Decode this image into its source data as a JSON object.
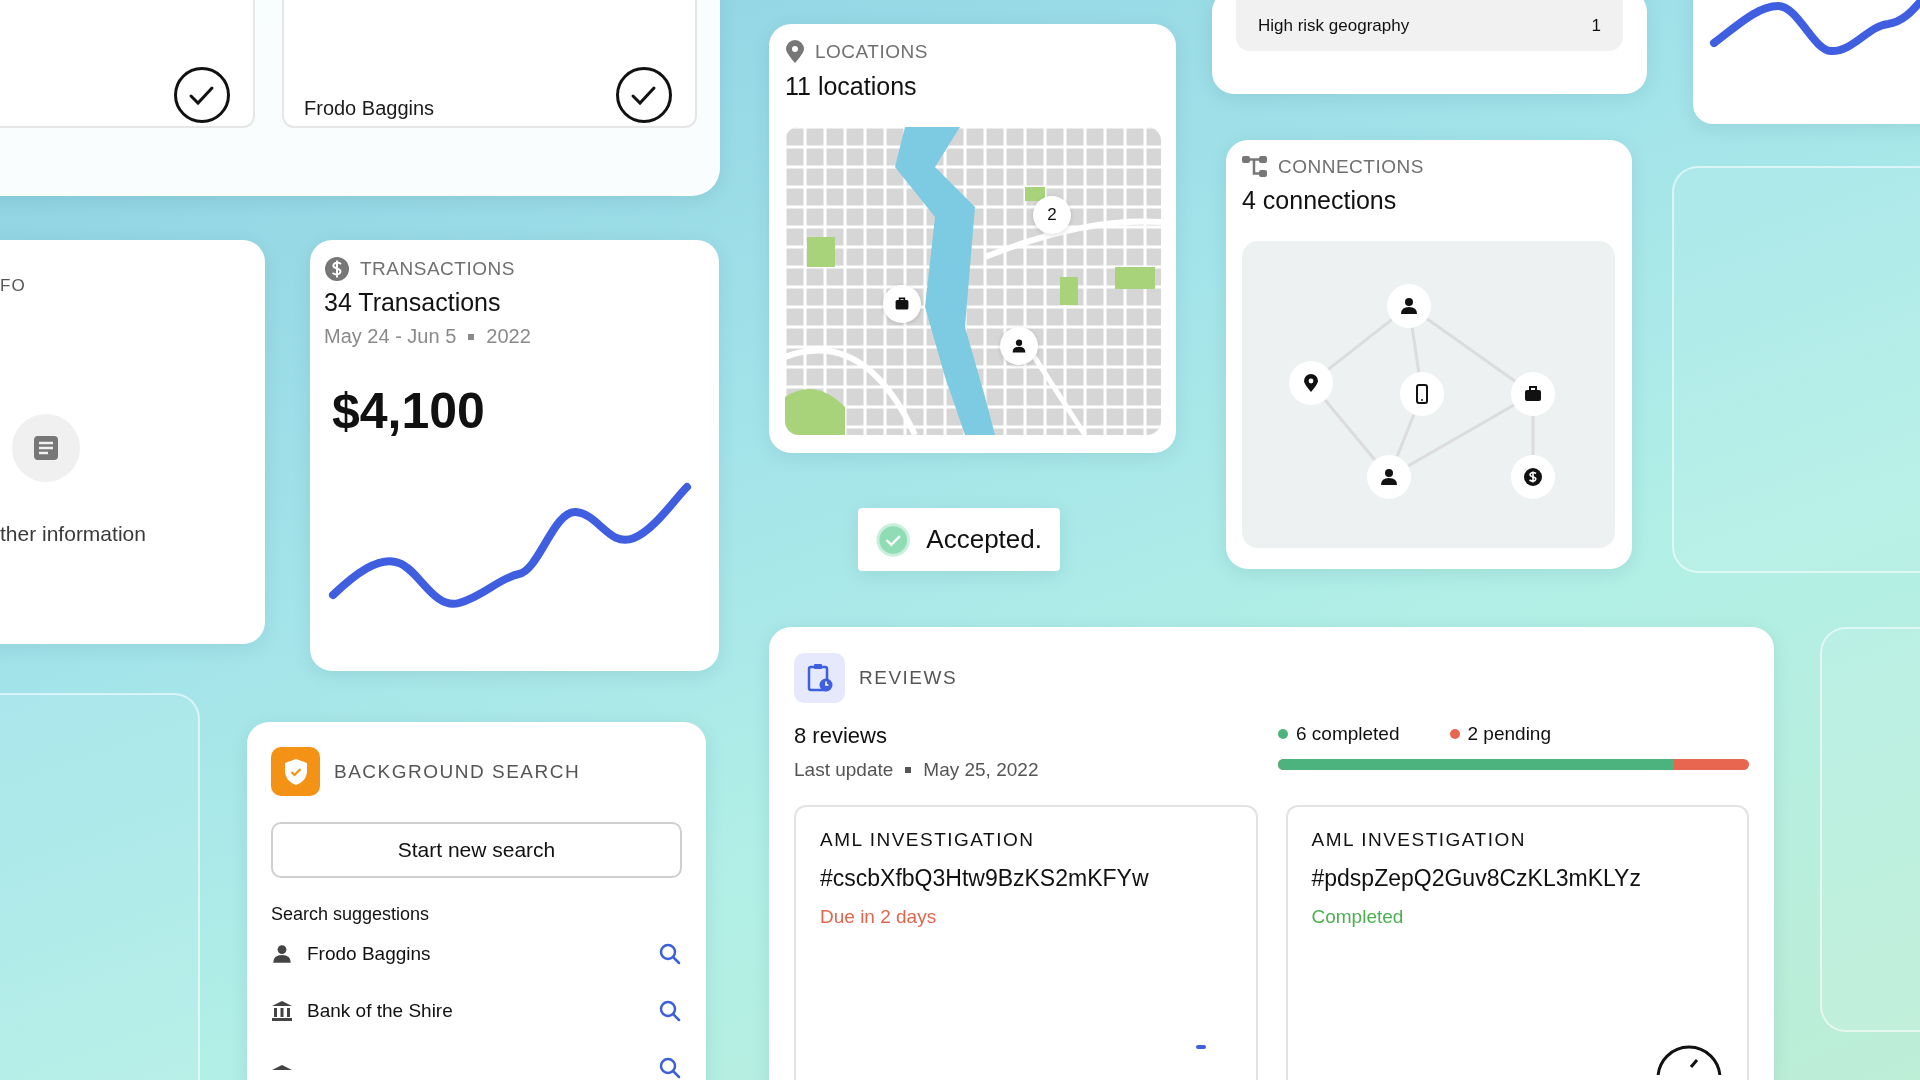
{
  "people_panel": {
    "cards": [
      {
        "checked": true
      },
      {
        "label": "Frodo Baggins",
        "checked": true
      }
    ]
  },
  "info_card": {
    "title": "FO",
    "caption": "ther information"
  },
  "transactions": {
    "title": "TRANSACTIONS",
    "count": "34 Transactions",
    "range": "May 24 - Jun 5",
    "year": "2022",
    "amount": "$4,100"
  },
  "locations": {
    "title": "LOCATIONS",
    "count": "11 locations",
    "markers": [
      {
        "kind": "briefcase"
      },
      {
        "kind": "cluster",
        "label": "2"
      },
      {
        "kind": "person"
      }
    ]
  },
  "toast": {
    "text": "Accepted."
  },
  "risk": {
    "label": "High risk geography",
    "value": "1"
  },
  "connections": {
    "title": "CONNECTIONS",
    "count": "4 connections"
  },
  "background_search": {
    "title": "BACKGROUND SEARCH",
    "button": "Start new search",
    "suggestions_label": "Search suggestions",
    "suggestions": [
      {
        "kind": "person",
        "name": "Frodo Baggins"
      },
      {
        "kind": "bank",
        "name": "Bank of the Shire"
      },
      {
        "kind": "place"
      }
    ]
  },
  "reviews": {
    "title": "REVIEWS",
    "count": "8 reviews",
    "updated_label": "Last update",
    "updated": "May 25, 2022",
    "legend": [
      {
        "label": "6 completed",
        "color": "#4db37e"
      },
      {
        "label": "2 pending",
        "color": "#e8664f"
      }
    ],
    "progress": {
      "level": 0.84
    },
    "items": [
      {
        "type": "AML INVESTIGATION",
        "id": "#cscbXfbQ3Htw9BzKS2mKFYw",
        "status": "Due in 2 days",
        "kind": "due"
      },
      {
        "type": "AML INVESTIGATION",
        "id": "#pdspZepQ2Guv8CzKL3mKLYz",
        "status": "Completed",
        "kind": "completed"
      }
    ]
  }
}
